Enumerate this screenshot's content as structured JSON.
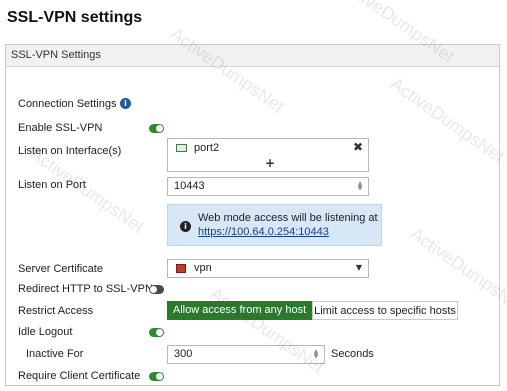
{
  "page_heading": "SSL-VPN settings",
  "panel": {
    "header": "SSL-VPN Settings",
    "connection_settings_title": "Connection Settings"
  },
  "fields": {
    "enable_sslvpn": {
      "label": "Enable SSL-VPN",
      "state": "on"
    },
    "listen_on_interfaces": {
      "label": "Listen on Interface(s)",
      "value": "port2"
    },
    "listen_on_port": {
      "label": "Listen on Port",
      "value": "10443"
    },
    "web_mode_notice": {
      "text": "Web mode access will be listening at",
      "link": "https://100.64.0.254:10443"
    },
    "server_certificate": {
      "label": "Server Certificate",
      "value": "vpn"
    },
    "redirect_http": {
      "label": "Redirect HTTP to SSL-VPN",
      "state": "off"
    },
    "restrict_access": {
      "label": "Restrict Access",
      "options": [
        "Allow access from any host",
        "Limit access to specific hosts"
      ],
      "selected": "Allow access from any host"
    },
    "idle_logout": {
      "label": "Idle Logout",
      "state": "on"
    },
    "inactive_for": {
      "label": "Inactive For",
      "value": "300",
      "unit": "Seconds"
    },
    "require_client_cert": {
      "label": "Require Client Certificate",
      "state": "on"
    }
  },
  "colors": {
    "toggle_on": "#2f8a2f",
    "toggle_off": "#4a4a4a",
    "active_segment": "#2b7a2b",
    "notice_bg": "#d7e7f6",
    "link": "#1a3f8f"
  },
  "watermark": "ActiveDumpsNet"
}
